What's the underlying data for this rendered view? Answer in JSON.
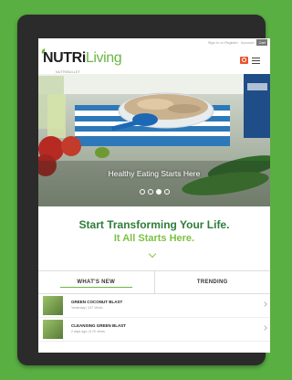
{
  "topbar": {
    "signin": "Sign In or Register",
    "account": "Account",
    "cart": "Cart"
  },
  "logo": {
    "part1": "NUTRi",
    "part2": "Living",
    "sub": "NUTRIBULLET"
  },
  "hero": {
    "caption": "Healthy Eating Starts Here",
    "slides": 4,
    "active_slide": 2
  },
  "tagline": {
    "line1": "Start Transforming Your Life.",
    "line2": "It All Starts Here."
  },
  "tabs": [
    {
      "label": "WHAT'S NEW",
      "active": true
    },
    {
      "label": "TRENDING",
      "active": false
    }
  ],
  "items": [
    {
      "title": "GREEN COCONUT BLAST",
      "meta": "Yesterday  |  437 Views"
    },
    {
      "title": "CLEANSING GREEN BLAST",
      "meta": "2 days ago  |  8.7K views"
    }
  ],
  "colors": {
    "background": "#5aaf43",
    "brand_green": "#6bb645",
    "dark_green": "#2e7d3a",
    "accent_orange": "#e8552e"
  }
}
